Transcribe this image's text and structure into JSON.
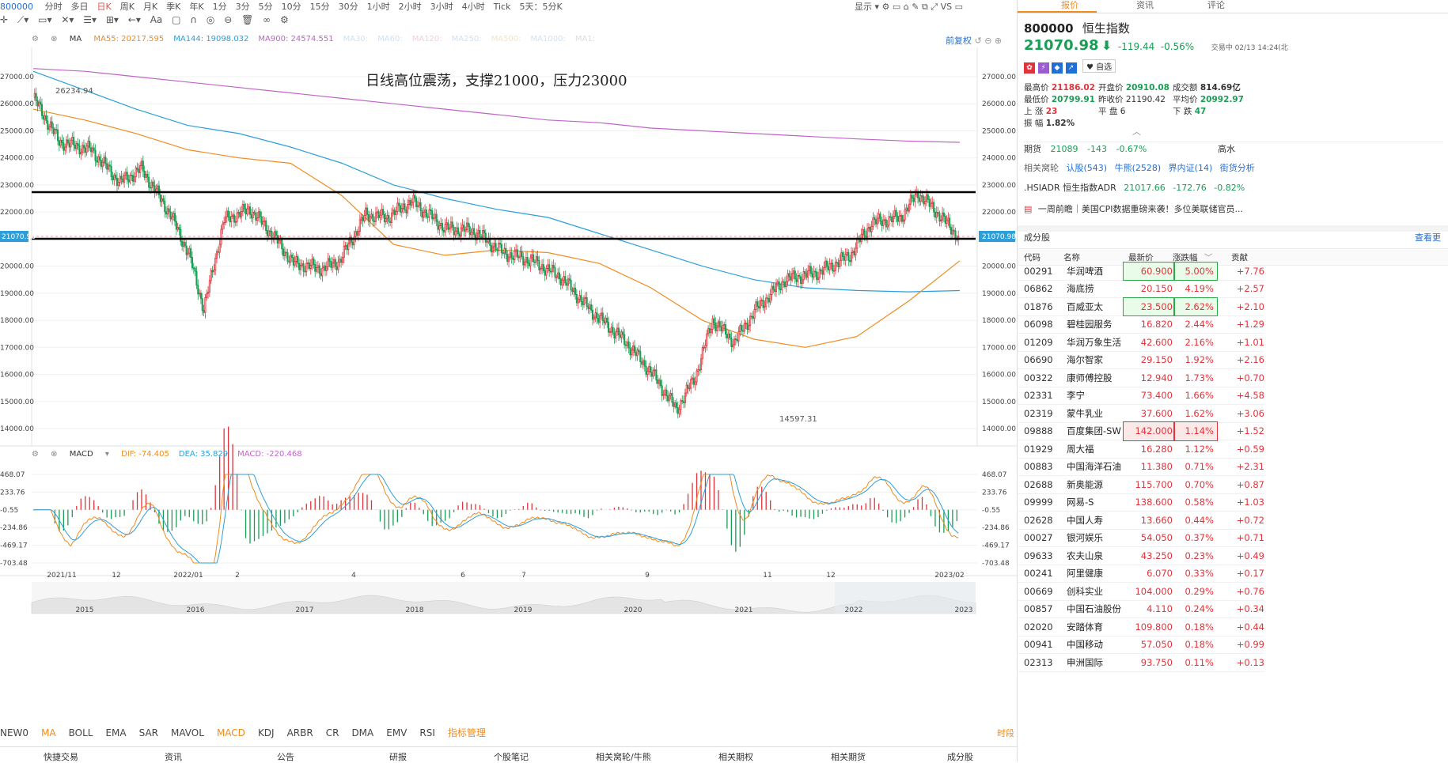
{
  "toolbar": {
    "code": "800000",
    "periods": [
      "分时",
      "多日",
      "日K",
      "周K",
      "月K",
      "季K",
      "年K",
      "1分",
      "3分",
      "5分",
      "10分",
      "15分",
      "30分",
      "1小时",
      "2小时",
      "3小时",
      "4小时",
      "Tick",
      "5天：5分K"
    ],
    "active_period": "日K",
    "display": "显示",
    "tool_aa": "Aa"
  },
  "chart": {
    "annotation": "日线高位震荡，支撑21000，压力23000",
    "ma_label": "MA",
    "ma_legend": [
      {
        "label": "MA55: 20217.595",
        "color": "#f08b1e"
      },
      {
        "label": "MA144: 19098.032",
        "color": "#2d9fd8"
      },
      {
        "label": "MA900: 24574.551",
        "color": "#c064c8"
      },
      {
        "label": "MA30:",
        "color": "#cfe1f5"
      },
      {
        "label": "MA60:",
        "color": "#cfe1f5"
      },
      {
        "label": "MA120:",
        "color": "#f5cfd7"
      },
      {
        "label": "MA250:",
        "color": "#cfe1f5"
      },
      {
        "label": "MA500:",
        "color": "#f7e3c4"
      },
      {
        "label": "MA1000:",
        "color": "#cfe1f5"
      },
      {
        "label": "MA1:",
        "color": "#dddddd"
      }
    ],
    "adjust": "前复权",
    "price_ticks_right": [
      "27000.00",
      "26000.00",
      "25000.00",
      "24000.00",
      "23000.00",
      "22000.00",
      "21000.00",
      "20000.00",
      "19000.00",
      "18000.00",
      "17000.00",
      "16000.00",
      "15000.00",
      "14000.00"
    ],
    "price_ticks_left": [
      "27000.00",
      "26000.00",
      "25000.00",
      "24000.00",
      "23000.00",
      "22000.00",
      "",
      "20000.00",
      "19000.00",
      "18000.00",
      "17000.00",
      "16000.00",
      "15000.00",
      "14000.00"
    ],
    "current_price_tag": "21070.98",
    "high_label": "26234.94",
    "low_label": "14597.31",
    "macd_label": "MACD",
    "macd_legend": [
      {
        "label": "DIF: -74.405",
        "color": "#f08b1e"
      },
      {
        "label": "DEA: 35.829",
        "color": "#2d9fd8"
      },
      {
        "label": "MACD: -220.468",
        "color": "#c064c8"
      }
    ],
    "macd_ticks": [
      "468.07",
      "233.76",
      "-0.55",
      "-234.86",
      "-469.17",
      "-703.48"
    ],
    "x_ticks": [
      "2021/11",
      "12",
      "2022/01",
      "2",
      "4",
      "6",
      "7",
      "9",
      "11",
      "12",
      "2023/02"
    ],
    "overview_years": [
      "2015",
      "2016",
      "2017",
      "2018",
      "2019",
      "2020",
      "2021",
      "2022",
      "2023"
    ]
  },
  "chart_data": {
    "type": "candlestick",
    "title": "日线高位震荡，支撑21000，压力23000",
    "y_range": [
      14000,
      27000
    ],
    "horizontal_lines": [
      23000,
      21000
    ],
    "current_price": 21070.98,
    "high": 26234.94,
    "low": 14597.31,
    "x_labels": [
      "2021/11",
      "12",
      "2022/01",
      "2",
      "4",
      "6",
      "7",
      "9",
      "11",
      "12",
      "2023/02"
    ],
    "series": [
      {
        "name": "MA55",
        "values": [
          25800,
          25400,
          24900,
          24300,
          24000,
          23800,
          22600,
          20800,
          20400,
          20600,
          20500,
          20100,
          19200,
          18000,
          17300,
          17000,
          17400,
          18700,
          20200
        ]
      },
      {
        "name": "MA144",
        "values": [
          27200,
          26500,
          25800,
          25200,
          24900,
          24400,
          23800,
          23000,
          22500,
          22100,
          21800,
          21200,
          20600,
          20000,
          19500,
          19200,
          19100,
          19050,
          19098
        ]
      },
      {
        "name": "MA900",
        "values": [
          27300,
          27200,
          27000,
          26800,
          26600,
          26400,
          26200,
          26000,
          25800,
          25600,
          25400,
          25300,
          25100,
          25000,
          24900,
          24800,
          24700,
          24620,
          24575
        ]
      }
    ],
    "macd": {
      "DIF": -74.405,
      "DEA": 35.829,
      "MACD": -220.468,
      "y_range": [
        -703.48,
        468.07
      ]
    }
  },
  "indicators": {
    "items": [
      "NEW0",
      "MA",
      "BOLL",
      "EMA",
      "SAR",
      "MAVOL",
      "MACD",
      "KDJ",
      "ARBR",
      "CR",
      "DMA",
      "EMV",
      "RSI",
      "指标管理"
    ],
    "active": [
      "MA",
      "MACD"
    ],
    "right": "时段"
  },
  "bottom_nav": [
    "快捷交易",
    "资讯",
    "公告",
    "研报",
    "个股笔记",
    "相关窝轮/牛熊",
    "相关期权",
    "相关期货",
    "成分股"
  ],
  "panel": {
    "tabs": [
      "报价",
      "资讯",
      "评论"
    ],
    "code": "800000",
    "name": "恒生指数",
    "price": "21070.98",
    "change": "-119.44",
    "change_pct": "-0.56%",
    "status": "交易中 02/13 14:24(北",
    "watch": "自选",
    "stats": {
      "high_label": "最高价",
      "high": "21186.02",
      "open_label": "开盘价",
      "open": "20910.08",
      "amount_label": "成交额",
      "amount": "814.69亿",
      "low_label": "最低价",
      "low": "20799.91",
      "prev_label": "昨收价",
      "prev": "21190.42",
      "avg_label": "平均价",
      "avg": "20992.97",
      "up_label": "上 涨",
      "up": "23",
      "flat_label": "平 盘",
      "flat": "6",
      "down_label": "下 跌",
      "down": "47",
      "amp_label": "振 幅",
      "amp": "1.82%"
    },
    "futures": {
      "label": "期货",
      "price": "21089",
      "chg": "-143",
      "pct": "-0.67%",
      "right": "高水"
    },
    "warrants": {
      "label": "相关窝轮",
      "items": [
        "认股(543)",
        "牛熊(2528)",
        "界内证(14)",
        "街货分析"
      ]
    },
    "adr": {
      "label": ".HSIADR 恒生指数ADR",
      "price": "21017.66",
      "chg": "-172.76",
      "pct": "-0.82%"
    },
    "news": "一周前瞻｜美国CPI数据重磅来袭！多位美联储官员...",
    "constituents_title": "成分股",
    "view_more": "查看更",
    "table_headers": [
      "代码",
      "名称",
      "最新价",
      "涨跌幅",
      "贡献"
    ],
    "stocks": [
      {
        "code": "00291",
        "name": "华润啤酒",
        "price": "60.900",
        "pct": "5.00%",
        "contrib": "+7.76",
        "hl": "g"
      },
      {
        "code": "06862",
        "name": "海底捞",
        "price": "20.150",
        "pct": "4.19%",
        "contrib": "+2.57",
        "hl": ""
      },
      {
        "code": "01876",
        "name": "百威亚太",
        "price": "23.500",
        "pct": "2.62%",
        "contrib": "+2.10",
        "hl": "g"
      },
      {
        "code": "06098",
        "name": "碧桂园服务",
        "price": "16.820",
        "pct": "2.44%",
        "contrib": "+1.29",
        "hl": ""
      },
      {
        "code": "01209",
        "name": "华润万象生活",
        "price": "42.600",
        "pct": "2.16%",
        "contrib": "+1.01",
        "hl": ""
      },
      {
        "code": "06690",
        "name": "海尔智家",
        "price": "29.150",
        "pct": "1.92%",
        "contrib": "+2.16",
        "hl": ""
      },
      {
        "code": "00322",
        "name": "康师傅控股",
        "price": "12.940",
        "pct": "1.73%",
        "contrib": "+0.70",
        "hl": ""
      },
      {
        "code": "02331",
        "name": "李宁",
        "price": "73.400",
        "pct": "1.66%",
        "contrib": "+4.58",
        "hl": ""
      },
      {
        "code": "02319",
        "name": "蒙牛乳业",
        "price": "37.600",
        "pct": "1.62%",
        "contrib": "+3.06",
        "hl": ""
      },
      {
        "code": "09888",
        "name": "百度集团-SW",
        "price": "142.000",
        "pct": "1.14%",
        "contrib": "+1.52",
        "hl": "r"
      },
      {
        "code": "01929",
        "name": "周大福",
        "price": "16.280",
        "pct": "1.12%",
        "contrib": "+0.59",
        "hl": ""
      },
      {
        "code": "00883",
        "name": "中国海洋石油",
        "price": "11.380",
        "pct": "0.71%",
        "contrib": "+2.31",
        "hl": ""
      },
      {
        "code": "02688",
        "name": "新奥能源",
        "price": "115.700",
        "pct": "0.70%",
        "contrib": "+0.87",
        "hl": ""
      },
      {
        "code": "09999",
        "name": "网易-S",
        "price": "138.600",
        "pct": "0.58%",
        "contrib": "+1.03",
        "hl": ""
      },
      {
        "code": "02628",
        "name": "中国人寿",
        "price": "13.660",
        "pct": "0.44%",
        "contrib": "+0.72",
        "hl": ""
      },
      {
        "code": "00027",
        "name": "银河娱乐",
        "price": "54.050",
        "pct": "0.37%",
        "contrib": "+0.71",
        "hl": ""
      },
      {
        "code": "09633",
        "name": "农夫山泉",
        "price": "43.250",
        "pct": "0.23%",
        "contrib": "+0.49",
        "hl": ""
      },
      {
        "code": "00241",
        "name": "阿里健康",
        "price": "6.070",
        "pct": "0.33%",
        "contrib": "+0.17",
        "hl": ""
      },
      {
        "code": "00669",
        "name": "创科实业",
        "price": "104.000",
        "pct": "0.29%",
        "contrib": "+0.76",
        "hl": ""
      },
      {
        "code": "00857",
        "name": "中国石油股份",
        "price": "4.110",
        "pct": "0.24%",
        "contrib": "+0.34",
        "hl": ""
      },
      {
        "code": "02020",
        "name": "安踏体育",
        "price": "109.800",
        "pct": "0.18%",
        "contrib": "+0.44",
        "hl": ""
      },
      {
        "code": "00941",
        "name": "中国移动",
        "price": "57.050",
        "pct": "0.18%",
        "contrib": "+0.99",
        "hl": ""
      },
      {
        "code": "02313",
        "name": "申洲国际",
        "price": "93.750",
        "pct": "0.11%",
        "contrib": "+0.13",
        "hl": ""
      }
    ]
  }
}
